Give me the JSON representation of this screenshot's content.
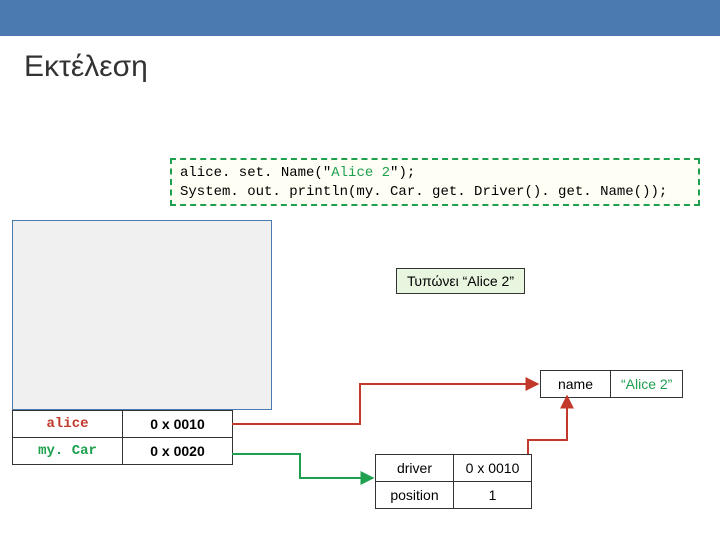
{
  "title": "Εκτέλεση",
  "code": {
    "line1_a": "alice. set. Name(\"",
    "line1_str": "Alice 2",
    "line1_b": "\");",
    "line2": "System. out. println(my. Car. get. Driver(). get. Name());"
  },
  "printLabel": "Τυπώνει “Alice 2”",
  "vars": {
    "r1_name": "alice",
    "r1_addr": "0 x 0010",
    "r2_name": "my. Car",
    "r2_addr": "0 x 0020"
  },
  "nameObj": {
    "label": "name",
    "value": "“Alice 2”"
  },
  "carObj": {
    "r1_label": "driver",
    "r1_value": "0 x 0010",
    "r2_label": "position",
    "r2_value": "1"
  }
}
